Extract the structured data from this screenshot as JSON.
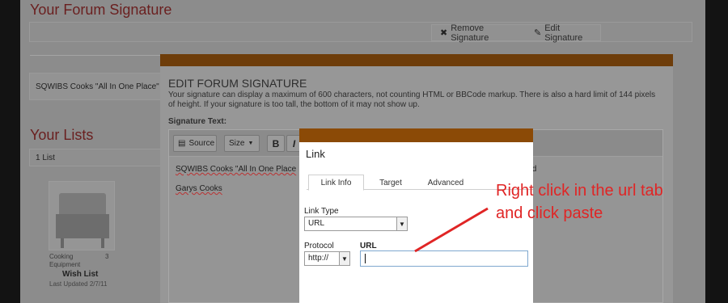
{
  "page": {
    "title": "Your Forum Signature",
    "actions": {
      "remove": "Remove Signature",
      "edit": "Edit Signature"
    },
    "signature_preview": "SQWIBS Cooks \"All In One Place\"",
    "lists_title": "Your Lists",
    "lists_count": "1 List",
    "list_item": {
      "category": "Cooking\nEquipment",
      "count": "3",
      "name": "Wish List",
      "updated": "Last Updated 2/7/11"
    }
  },
  "signature_modal": {
    "title": "EDIT FORUM SIGNATURE",
    "description": "Your signature can display a maximum of 600 characters, not counting HTML or BBCode markup. There is also a hard limit of 144 pixels of height. If your signature is too tall, the bottom of it may not show up.",
    "label": "Signature Text:",
    "toolbar": {
      "source": "Source",
      "size": "Size",
      "bold": "B",
      "italic": "I"
    },
    "editor_line1": "SQWIBS Cooks \"All In One Place",
    "editor_line1_tail": "old",
    "editor_line2": "Garys Cooks"
  },
  "link_dialog": {
    "title": "Link",
    "tabs": [
      "Link Info",
      "Target",
      "Advanced"
    ],
    "link_type_label": "Link Type",
    "link_type_value": "URL",
    "protocol_label": "Protocol",
    "protocol_value": "http://",
    "url_label": "URL",
    "url_value": ""
  },
  "annotation": {
    "line1": "Right click in the url tab",
    "line2": "and click paste",
    "color": "#e02525"
  },
  "colors": {
    "header_bar": "#8b4a06",
    "title_red": "#6a1f1f"
  }
}
